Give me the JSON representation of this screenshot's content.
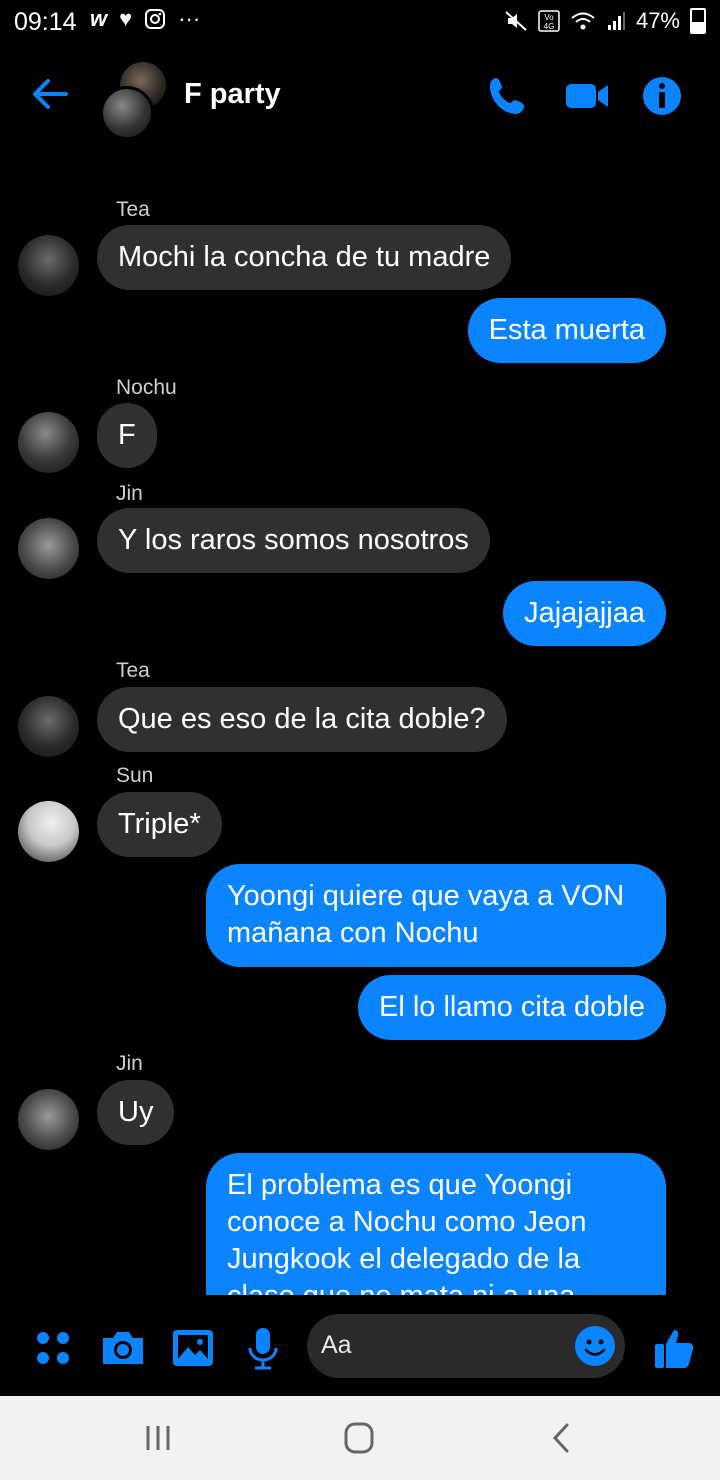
{
  "status_bar": {
    "time": "09:14",
    "battery": "47%"
  },
  "header": {
    "title": "F party"
  },
  "messages": [
    {
      "type": "label",
      "text": "Tea"
    },
    {
      "type": "in",
      "text": "Mochi la concha de tu madre",
      "avatar": "tea"
    },
    {
      "type": "out",
      "text": "Esta muerta"
    },
    {
      "type": "label",
      "text": "Nochu"
    },
    {
      "type": "in",
      "text": "F",
      "avatar": "nochu"
    },
    {
      "type": "label",
      "text": "Jin"
    },
    {
      "type": "in",
      "text": "Y los raros somos nosotros",
      "avatar": "jin"
    },
    {
      "type": "out",
      "text": "Jajajajjaa"
    },
    {
      "type": "label",
      "text": "Tea"
    },
    {
      "type": "in",
      "text": "Que es eso de la cita doble?",
      "avatar": "tea"
    },
    {
      "type": "label",
      "text": "Sun"
    },
    {
      "type": "in",
      "text": "Triple*",
      "avatar": "sun"
    },
    {
      "type": "out",
      "text": "Yoongi quiere que vaya a VON mañana con Nochu"
    },
    {
      "type": "out",
      "text": "El lo llamo cita doble"
    },
    {
      "type": "label",
      "text": "Jin"
    },
    {
      "type": "in",
      "text": "Uy",
      "avatar": "jin"
    },
    {
      "type": "out",
      "text": "El problema es que Yoongi conoce a Nochu como Jeon Jungkook el delegado de la clase que no mata ni a una"
    }
  ],
  "composer": {
    "placeholder": "Aa"
  },
  "colors": {
    "accent": "#0a84ff",
    "incoming_bubble": "#303030",
    "background": "#000000"
  }
}
